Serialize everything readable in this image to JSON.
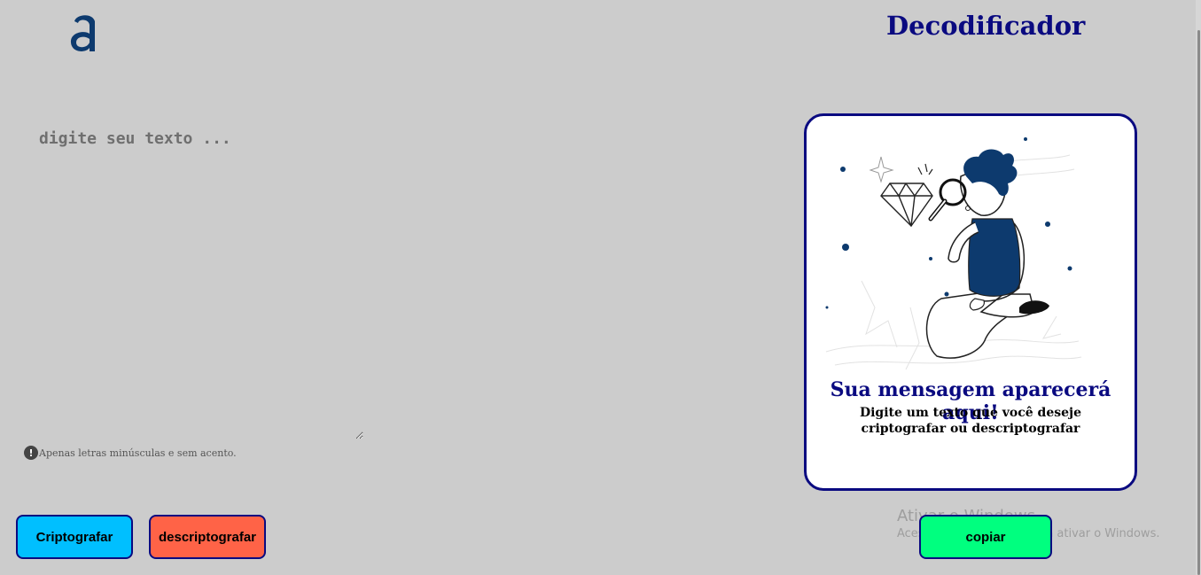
{
  "header": {
    "logo_icon": "alura-a-logo",
    "title": "Decodificador"
  },
  "input": {
    "placeholder": "digite seu texto ...",
    "value": ""
  },
  "hint": {
    "icon": "exclamation-circle-icon",
    "text": "Apenas letras minúsculas e sem acento."
  },
  "buttons": {
    "encrypt_label": "Criptografar",
    "decrypt_label": "descriptografar",
    "copy_label": "copiar"
  },
  "output": {
    "illustration": "person-with-magnifying-glass",
    "heading": "Sua mensagem aparecerá aqui!",
    "subtext": "Digite um texto que você deseje criptografar ou descriptografar"
  },
  "watermark": {
    "title": "Ativar o Windows",
    "subtitle": "Acesse Configurações para ativar o Windows."
  },
  "colors": {
    "background": "#cccccc",
    "accent": "#0a0a80",
    "encrypt": "#00bfff",
    "decrypt": "#ff6347",
    "copy": "#00ff7f"
  }
}
